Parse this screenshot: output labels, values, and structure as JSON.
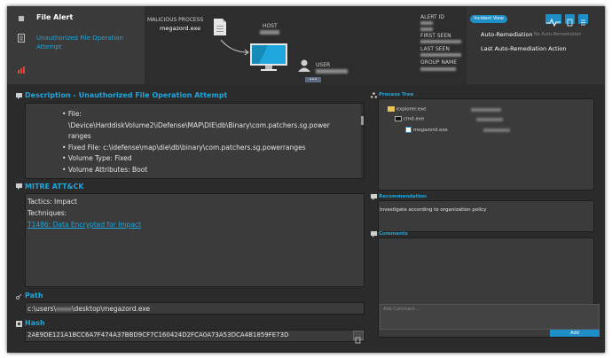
{
  "header": {
    "app_title": "File Alert",
    "alert_title": "Unauthorized File Operation Attempt",
    "malicious_process_label": "MALICIOUS PROCESS",
    "malicious_process_value": "megazord.exe",
    "host_label": "HOST",
    "user_label": "USER",
    "more_label": "•••",
    "alert_id_label": "ALERT ID",
    "first_seen_label": "FIRST SEEN",
    "last_seen_label": "LAST SEEN",
    "group_name_label": "GROUP NAME",
    "incident_view_label": "Incident View",
    "auto_remediation_label": "Auto-Remediation",
    "auto_remediation_value": "No Auto-Remediation",
    "last_auto_remediation_label": "Last Auto-Remediation Action"
  },
  "description": {
    "title": "Description - Unauthorized File Operation Attempt",
    "items": [
      "File:",
      "\\Device\\HarddiskVolume2\\iDefense\\MAP\\DIE\\db\\Binary\\com.patchers.sg.power",
      "ranges",
      "Fixed File: c:\\idefense\\map\\die\\db\\binary\\com.patchers.sg.powerranges",
      "Volume Type: Fixed",
      "Volume Attributes: Boot"
    ]
  },
  "mitre": {
    "title": "MITRE ATT&CK",
    "tactics": "Tactics: Impact",
    "techniques": "Techniques:",
    "technique_link": "T1486: Data Encrypted for Impact"
  },
  "path": {
    "title": "Path",
    "value_prefix": "c:\\users\\",
    "value_suffix": "\\desktop\\megazord.exe"
  },
  "hash": {
    "title": "Hash",
    "value": "2AE9DE121A1BCC6A7F474A37BBD9CF7C160424D2FCA0A73A53DCA4B1859FE73D"
  },
  "process_tree": {
    "title": "Process Tree",
    "nodes": [
      "explorer.exe",
      "cmd.exe",
      "megazord.exe"
    ]
  },
  "recommendation": {
    "title": "Recommendation",
    "text": "Investigate according to organization policy"
  },
  "comments": {
    "title": "Comments",
    "placeholder": "Add Comment...",
    "add_label": "Add"
  },
  "colors": {
    "accent": "#1fa6dc",
    "button": "#1e8fc6",
    "panel": "#3b3b3b",
    "background": "#2b2b2b"
  }
}
